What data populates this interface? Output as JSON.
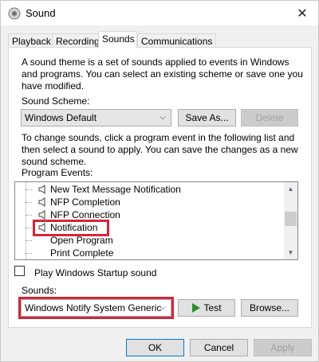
{
  "window": {
    "title": "Sound",
    "close_glyph": "✕"
  },
  "tabs": [
    {
      "label": "Playback",
      "active": false
    },
    {
      "label": "Recording",
      "active": false
    },
    {
      "label": "Sounds",
      "active": true
    },
    {
      "label": "Communications",
      "active": false
    }
  ],
  "intro": {
    "line1": "A sound theme is a set of sounds applied to events in Windows",
    "line2": "and programs.  You can select an existing scheme or save one you",
    "line3": "have modified."
  },
  "scheme": {
    "label": "Sound Scheme:",
    "value": "Windows Default",
    "save_as": "Save As...",
    "delete": "Delete"
  },
  "instructions": {
    "line1": "To change sounds, click a program event in the following list and",
    "line2": "then select a sound to apply.  You can save the changes as a new",
    "line3": "sound scheme."
  },
  "events": {
    "label": "Program Events:",
    "items": [
      {
        "label": "New Text Message Notification",
        "has_sound": true,
        "selected": false
      },
      {
        "label": "NFP Completion",
        "has_sound": true,
        "selected": false
      },
      {
        "label": "NFP Connection",
        "has_sound": true,
        "selected": false
      },
      {
        "label": "Notification",
        "has_sound": true,
        "selected": true
      },
      {
        "label": "Open Program",
        "has_sound": false,
        "selected": false
      },
      {
        "label": "Print Complete",
        "has_sound": false,
        "selected": false
      }
    ]
  },
  "startup": {
    "label": "Play Windows Startup sound",
    "checked": false
  },
  "sounds": {
    "label": "Sounds:",
    "value": "Windows Notify System Generic",
    "test": "Test",
    "browse": "Browse..."
  },
  "dialog": {
    "ok": "OK",
    "cancel": "Cancel",
    "apply": "Apply"
  },
  "colors": {
    "highlight": "#d3263b",
    "play_green": "#2e8b2e",
    "accent": "#0078d7"
  }
}
